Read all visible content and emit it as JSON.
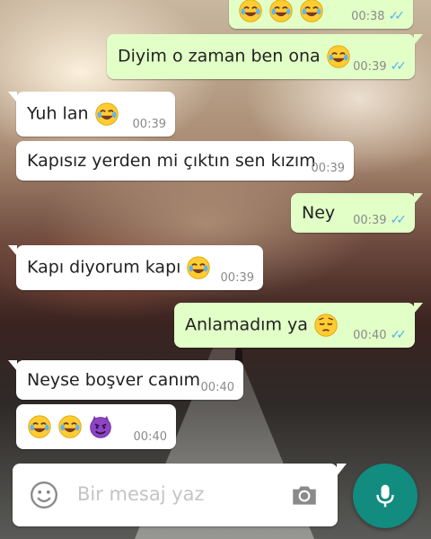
{
  "messages": [
    {
      "direction": "out",
      "text": "",
      "emojis": [
        "joy-emoji",
        "joy-emoji",
        "joy-emoji"
      ],
      "time": "00:38",
      "read": true
    },
    {
      "direction": "out",
      "text": "Diyim o zaman ben ona",
      "emojis": [
        "joy-emoji"
      ],
      "time": "00:39",
      "read": true
    },
    {
      "direction": "in",
      "text": "Yuh lan",
      "emojis": [
        "joy-emoji"
      ],
      "time": "00:39"
    },
    {
      "direction": "in",
      "text": "Kapısız yerden mi çıktın sen kızım",
      "emojis": [],
      "time": "00:39"
    },
    {
      "direction": "out",
      "text": "Ney",
      "emojis": [],
      "time": "00:39",
      "read": true
    },
    {
      "direction": "in",
      "text": "Kapı diyorum kapı",
      "emojis": [
        "joy-emoji"
      ],
      "time": "00:39"
    },
    {
      "direction": "out",
      "text": "Anlamadım ya",
      "emojis": [
        "pensive-emoji"
      ],
      "time": "00:40",
      "read": true
    },
    {
      "direction": "in",
      "text": "Neyse boşver canım",
      "emojis": [],
      "time": "00:40"
    },
    {
      "direction": "in",
      "text": "",
      "emojis": [
        "joy-emoji",
        "joy-emoji",
        "imp-emoji"
      ],
      "time": "00:40"
    }
  ],
  "composer": {
    "placeholder": "Bir mesaj yaz",
    "emoji_icon": "smiley-icon",
    "camera_icon": "camera-icon",
    "mic_icon": "microphone-icon"
  },
  "colors": {
    "outgoing_bubble": "#e2ffc7",
    "incoming_bubble": "#ffffff",
    "read_ticks": "#4fb6ec",
    "mic_button": "#128c7e"
  }
}
